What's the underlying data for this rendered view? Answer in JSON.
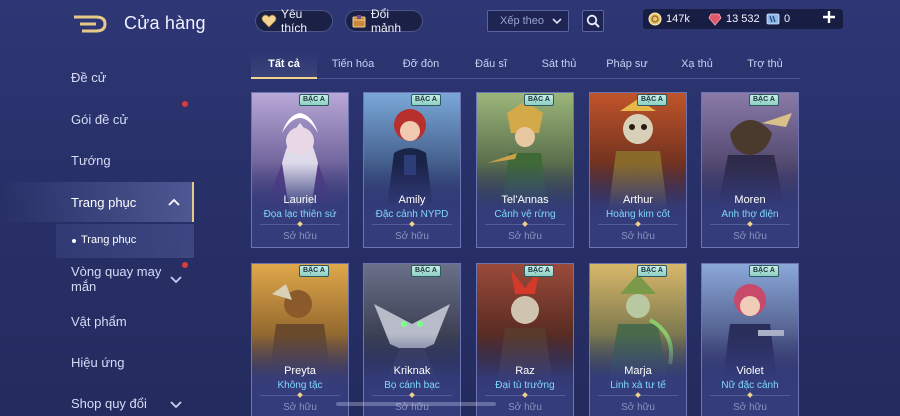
{
  "header": {
    "title": "Cửa hàng",
    "favorite_label": "Yêu thích",
    "exchange_label": "Đổi mảnh",
    "sort_placeholder": "Xếp theo",
    "currencies": {
      "vouchers": "147k",
      "gems": "13 532",
      "tickets": "0"
    }
  },
  "sidebar": {
    "items": [
      {
        "label": "Đề cử"
      },
      {
        "label": "Gói đề cử"
      },
      {
        "label": "Tướng"
      },
      {
        "label": "Trang phục"
      },
      {
        "label": "Vòng quay may mắn"
      },
      {
        "label": "Vật phẩm"
      },
      {
        "label": "Hiệu ứng"
      },
      {
        "label": "Shop quy đổi"
      }
    ],
    "sub_item": "Trang phục"
  },
  "tabs": [
    "Tất cả",
    "Tiến hóa",
    "Đỡ đòn",
    "Đấu sĩ",
    "Sát thủ",
    "Pháp sư",
    "Xạ thủ",
    "Trợ thủ"
  ],
  "cards": [
    {
      "badge": "BẬC A",
      "hero": "Lauriel",
      "skin": "Đọa lạc thiên sứ",
      "status": "Sở hữu"
    },
    {
      "badge": "BẬC A",
      "hero": "Amily",
      "skin": "Đặc cảnh NYPD",
      "status": "Sở hữu"
    },
    {
      "badge": "BẬC A",
      "hero": "Tel'Annas",
      "skin": "Cảnh vệ rừng",
      "status": "Sở hữu"
    },
    {
      "badge": "BẬC A",
      "hero": "Arthur",
      "skin": "Hoàng kim cốt",
      "status": "Sở hữu"
    },
    {
      "badge": "BẬC A",
      "hero": "Moren",
      "skin": "Anh thợ điện",
      "status": "Sở hữu"
    },
    {
      "badge": "BẬC A",
      "hero": "Preyta",
      "skin": "Không tặc",
      "status": "Sở hữu"
    },
    {
      "badge": "BẬC A",
      "hero": "Kriknak",
      "skin": "Bọ cánh bạc",
      "status": "Sở hữu"
    },
    {
      "badge": "BẬC A",
      "hero": "Raz",
      "skin": "Đại tù trưởng",
      "status": "Sở hữu"
    },
    {
      "badge": "BẬC A",
      "hero": "Marja",
      "skin": "Linh xà tư tế",
      "status": "Sở hữu"
    },
    {
      "badge": "BẬC A",
      "hero": "Violet",
      "skin": "Nữ đặc cảnh",
      "status": "Sở hữu"
    }
  ],
  "colors": {
    "accent_gold": "#f2d48c",
    "skin_name_blue": "#7fd7ff",
    "notification_red": "#e03a3a"
  }
}
